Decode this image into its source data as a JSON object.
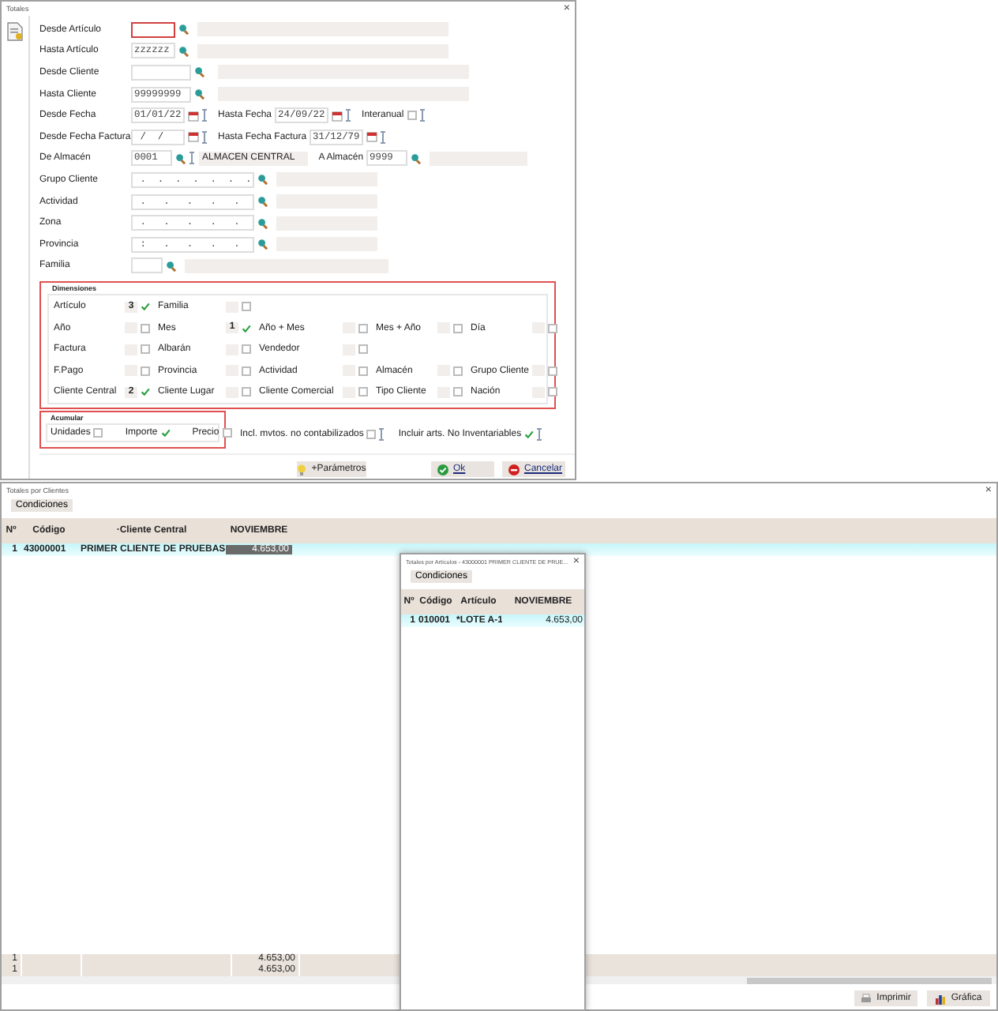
{
  "dialog": {
    "title": "Totales",
    "close": "×",
    "rows": [
      {
        "label": "Desde Artículo",
        "items": [
          {
            "kind": "lookup",
            "value": "",
            "focused": true
          },
          {
            "kind": "desc",
            "value": ""
          }
        ]
      },
      {
        "label": "Hasta Artículo",
        "items": [
          {
            "kind": "lookup",
            "value": "zzzzzz",
            "focused": false
          },
          {
            "kind": "desc",
            "value": ""
          }
        ]
      },
      {
        "label": "Desde Cliente",
        "items": [
          {
            "kind": "lookup",
            "value": "",
            "focused": false
          },
          {
            "kind": "desc",
            "value": ""
          }
        ]
      },
      {
        "label": "Hasta Cliente",
        "items": [
          {
            "kind": "lookup",
            "value": "99999999",
            "focused": false
          },
          {
            "kind": "desc",
            "value": ""
          }
        ]
      },
      {
        "label": "Desde Fecha",
        "items": [
          {
            "kind": "date",
            "value": "01/01/22"
          },
          {
            "kind": "text",
            "value": "Hasta Fecha"
          },
          {
            "kind": "date",
            "value": "24/09/22"
          },
          {
            "kind": "text",
            "value": "Interanual"
          },
          {
            "kind": "check",
            "checked": false
          }
        ]
      },
      {
        "label": "Desde Fecha Factura",
        "items": [
          {
            "kind": "date",
            "value": " /  / "
          },
          {
            "kind": "text",
            "value": "Hasta Fecha Factura"
          },
          {
            "kind": "date",
            "value": "31/12/79"
          }
        ]
      },
      {
        "label": "De Almacén",
        "items": [
          {
            "kind": "lookup",
            "value": "0001",
            "focused": false
          },
          {
            "kind": "desc",
            "value": "ALMACEN CENTRAL"
          },
          {
            "kind": "text",
            "value": "A Almacén"
          },
          {
            "kind": "lookup",
            "value": "9999",
            "focused": false
          },
          {
            "kind": "desc",
            "value": ""
          }
        ]
      },
      {
        "label": "Grupo Cliente",
        "items": [
          {
            "kind": "lookup",
            "value": " .  .  .  .  .  .  .",
            "focused": false
          },
          {
            "kind": "desc",
            "value": ""
          }
        ]
      },
      {
        "label": "Actividad",
        "items": [
          {
            "kind": "lookup",
            "value": " .   .   .   .   .",
            "focused": false
          },
          {
            "kind": "desc",
            "value": ""
          }
        ]
      },
      {
        "label": "Zona",
        "items": [
          {
            "kind": "lookup",
            "value": " .   .   .   .   .",
            "focused": false
          },
          {
            "kind": "desc",
            "value": ""
          }
        ]
      },
      {
        "label": "Provincia",
        "items": [
          {
            "kind": "lookup",
            "value": " :   .   .   .   .",
            "focused": false
          },
          {
            "kind": "desc",
            "value": ""
          }
        ]
      },
      {
        "label": "Familia",
        "items": [
          {
            "kind": "lookup",
            "value": "",
            "focused": false
          },
          {
            "kind": "desc",
            "value": ""
          }
        ]
      }
    ],
    "dimensions": {
      "title": "Dimensiones",
      "rows": [
        [
          {
            "label": "Artículo",
            "order": "3",
            "checked": true
          },
          {
            "label": "Familia",
            "checked": false
          }
        ],
        [
          {
            "label": "Año",
            "checked": false
          },
          {
            "label": "Mes",
            "order": "1",
            "checked": true
          },
          {
            "label": "Año + Mes",
            "checked": false
          },
          {
            "label": "Mes + Año",
            "checked": false
          },
          {
            "label": "Día",
            "checked": false
          }
        ],
        [
          {
            "label": "Factura",
            "checked": false
          },
          {
            "label": "Albarán",
            "checked": false
          },
          {
            "label": "Vendedor",
            "checked": false
          }
        ],
        [
          {
            "label": "F.Pago",
            "checked": false
          },
          {
            "label": "Provincia",
            "checked": false
          },
          {
            "label": "Actividad",
            "checked": false
          },
          {
            "label": "Almacén",
            "checked": false
          },
          {
            "label": "Grupo Cliente",
            "checked": false
          }
        ],
        [
          {
            "label": "Cliente Central",
            "order": "2",
            "checked": true
          },
          {
            "label": "Cliente Lugar",
            "checked": false
          },
          {
            "label": "Cliente Comercial",
            "checked": false
          },
          {
            "label": "Tipo Cliente",
            "checked": false
          },
          {
            "label": "Nación",
            "checked": false
          }
        ]
      ]
    },
    "accumulate": {
      "title": "Acumular",
      "options": [
        {
          "label": "Unidades",
          "checked": false
        },
        {
          "label": "Importe",
          "checked": true
        },
        {
          "label": "Precio",
          "checked": false
        }
      ]
    },
    "extras": [
      {
        "label": "Incl. mvtos. no contabilizados",
        "checked": false
      },
      {
        "label": "Incluir arts. No Inventariables",
        "checked": true
      }
    ],
    "buttons": [
      {
        "kind": "params",
        "label": "+Parámetros"
      },
      {
        "kind": "ok",
        "label": "Ok"
      },
      {
        "kind": "cancel",
        "label": "Cancelar"
      }
    ]
  },
  "clients_window": {
    "title": "Totales por Clientes",
    "close": "×",
    "tab": "Condiciones",
    "columns": [
      "Nº",
      "Código",
      "·Cliente Central",
      "NOVIEMBRE"
    ],
    "rows": [
      {
        "cells": [
          "1",
          "43000001",
          "PRIMER CLIENTE DE PRUEBAS",
          "4.653,00"
        ],
        "selected": true
      }
    ],
    "totals": [
      {
        "count": "1",
        "amount": "4.653,00"
      },
      {
        "count": "1",
        "amount": "4.653,00"
      }
    ],
    "buttons": [
      {
        "kind": "print",
        "label": "Imprimir"
      },
      {
        "kind": "chart",
        "label": "Gráfica"
      }
    ]
  },
  "articles_window": {
    "title": "Totales por Artículos - 43000001 PRIMER CLIENTE DE PRUE...",
    "close": "×",
    "tab": "Condiciones",
    "columns": [
      "Nº",
      "Código",
      "Artículo",
      "NOVIEMBRE"
    ],
    "rows": [
      {
        "cells": [
          "1",
          "010001",
          "*LOTE A-1",
          "4.653,00"
        ],
        "selected": true
      }
    ]
  }
}
